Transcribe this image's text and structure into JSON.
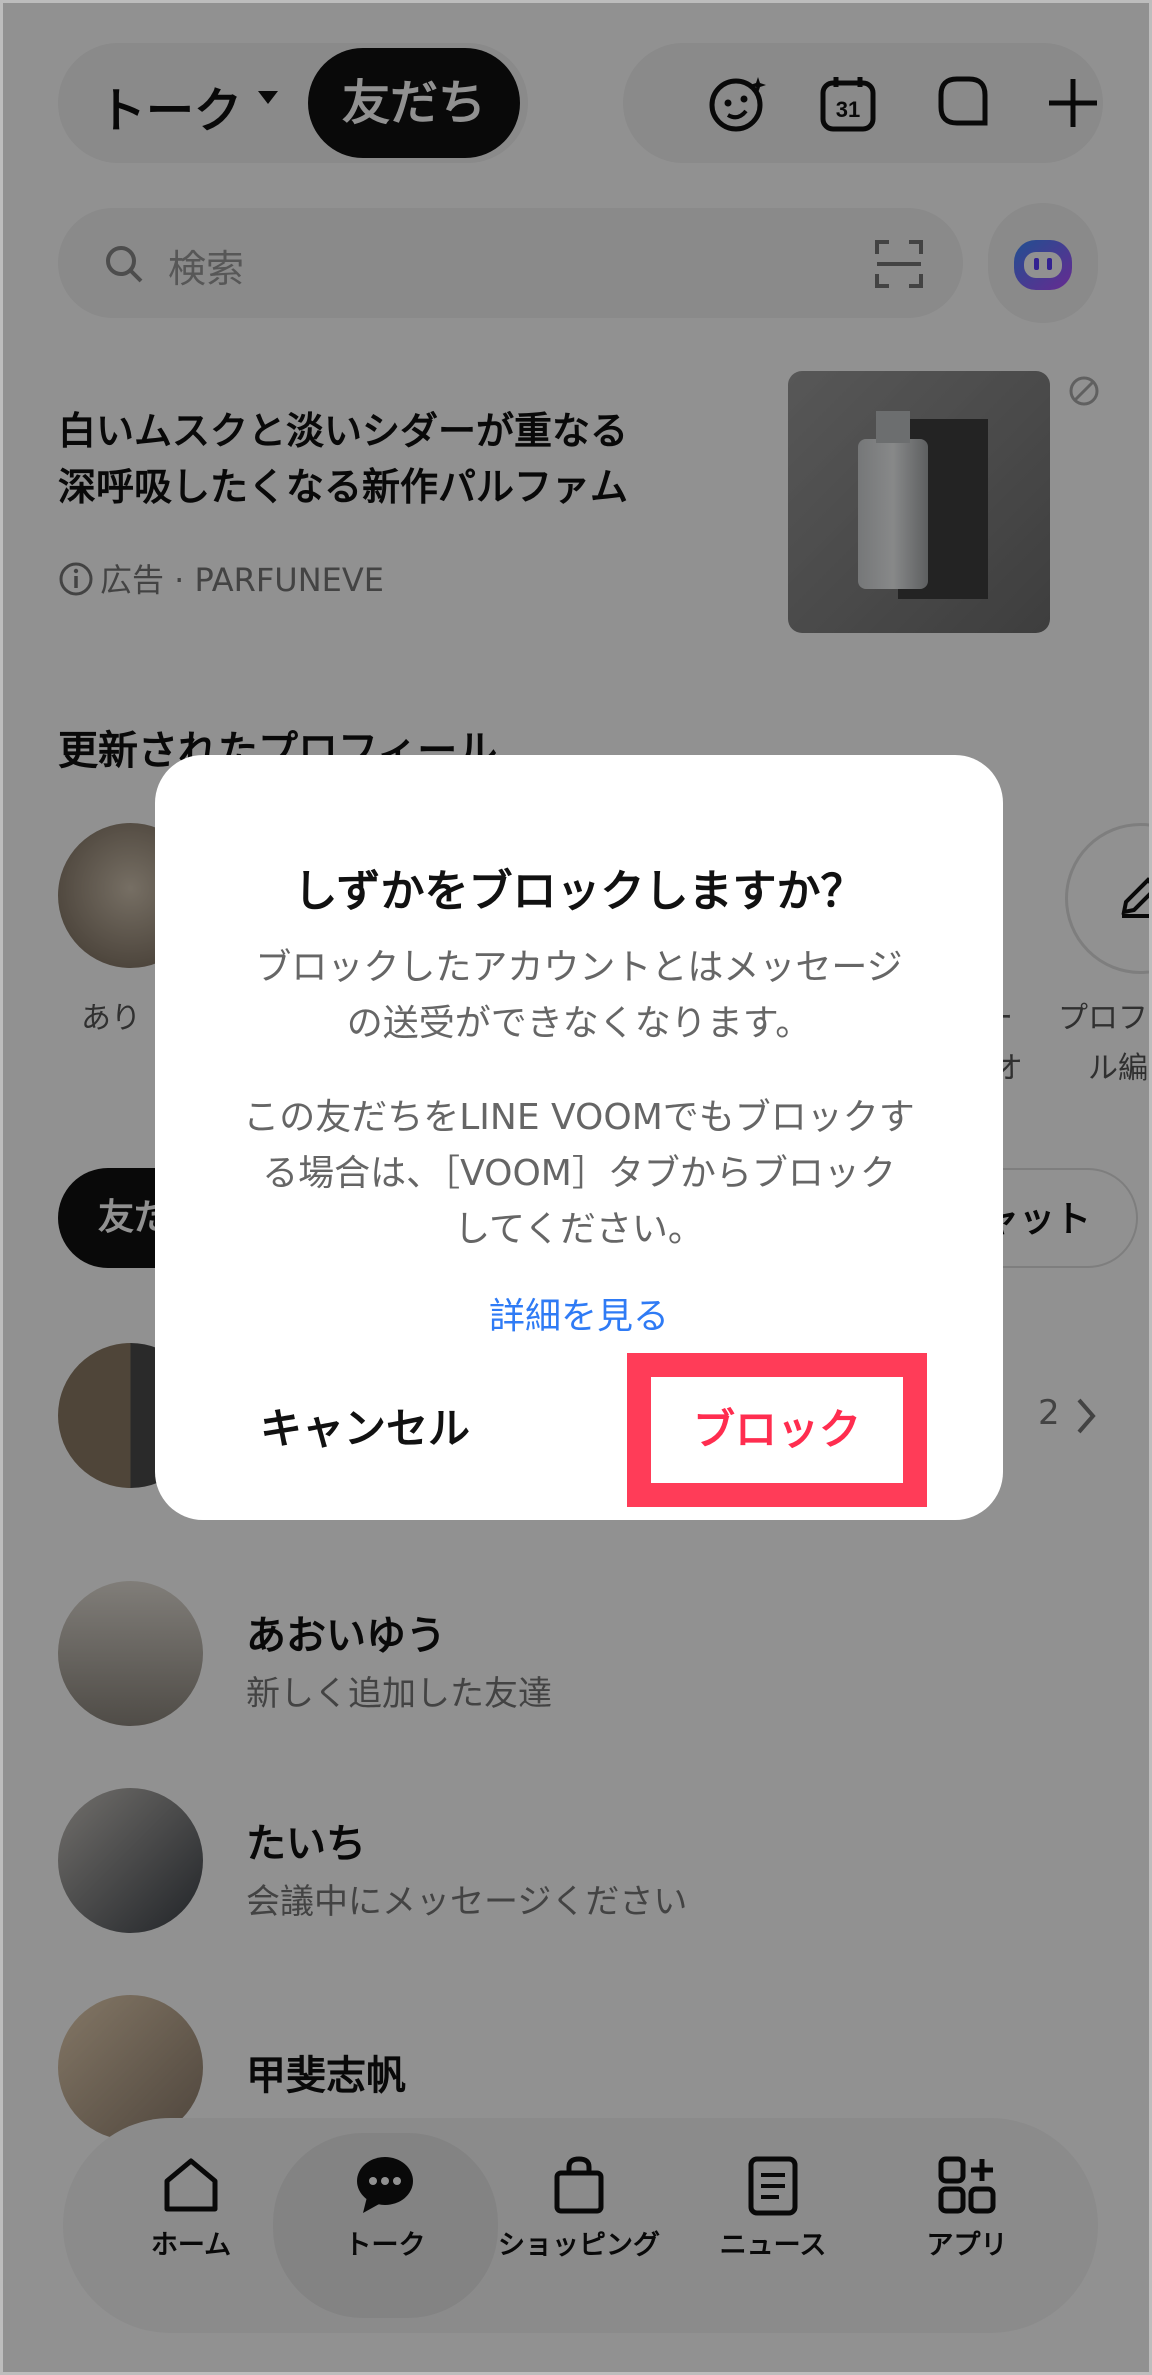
{
  "header": {
    "tab_talk": "トーク",
    "tab_friends": "友だち",
    "icons": [
      "sticker-face-icon",
      "calendar-icon",
      "chat-bubble-icon",
      "plus-icon"
    ],
    "calendar_day": "31"
  },
  "search": {
    "placeholder": "検索",
    "icons": [
      "search-icon",
      "qr-scan-icon",
      "ai-bot-icon"
    ]
  },
  "ad": {
    "title_line1": "白いムスクと淡いシダーが重なる",
    "title_line2": "深呼吸したくなる新作パルファム",
    "label": "広告 · PARFUNEVE"
  },
  "profiles": {
    "section_title": "更新されたプロフィール",
    "first_label": "あり",
    "right_label1": "ー",
    "right_label1b": "オ",
    "right_label2": "プロフ",
    "right_label2b": "ル編"
  },
  "chips": {
    "first": "友だ",
    "last": "ャット"
  },
  "group_row": {
    "count": "2"
  },
  "friends": [
    {
      "name": "あおいゆう",
      "status": "新しく追加した友達"
    },
    {
      "name": "たいち",
      "status": "会議中にメッセージください"
    },
    {
      "name": "甲斐志帆",
      "status": ""
    }
  ],
  "nav": [
    {
      "label": "ホーム",
      "icon": "home-icon"
    },
    {
      "label": "トーク",
      "icon": "talk-bubble-icon"
    },
    {
      "label": "ショッピング",
      "icon": "shopping-bag-icon"
    },
    {
      "label": "ニュース",
      "icon": "news-icon"
    },
    {
      "label": "アプリ",
      "icon": "apps-icon"
    }
  ],
  "dialog": {
    "title": "しずかをブロックしますか？",
    "body1_line1": "ブロックしたアカウントとはメッセージ",
    "body1_line2": "の送受ができなくなります。",
    "body2_line1": "この友だちをLINE VOOMでもブロックす",
    "body2_line2": "る場合は、［VOOM］タブからブロック",
    "body2_line3": "してください。",
    "link": "詳細を見る",
    "cancel": "キャンセル",
    "block": "ブロック"
  },
  "colors": {
    "accent_red": "#ff2d4f",
    "highlight_frame": "#ff3c58",
    "link_blue": "#2f7bf5"
  }
}
